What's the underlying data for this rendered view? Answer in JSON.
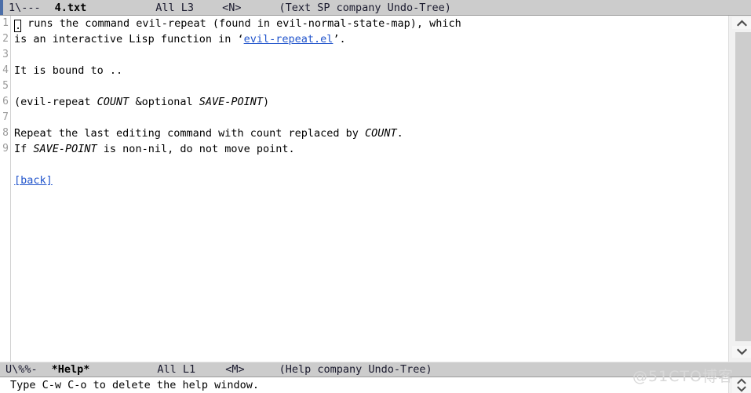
{
  "top_mode_line": {
    "flags": "1\\---",
    "buffer": "4.txt",
    "position": "All L3",
    "state": "<N>",
    "modes": "(Text SP company Undo-Tree)"
  },
  "bottom_mode_line": {
    "flags": "U\\%%-",
    "buffer": "*Help*",
    "position": "All L1",
    "state": "<M>",
    "modes": "(Help company Undo-Tree)"
  },
  "buffer": {
    "lines": [
      {
        "number": "1",
        "segments": [
          {
            "kind": "cursor",
            "text": "."
          },
          {
            "kind": "plain",
            "text": " runs the command evil-repeat (found in evil-normal-state-map), which"
          }
        ]
      },
      {
        "number": "2",
        "segments": [
          {
            "kind": "plain",
            "text": "is an interactive Lisp function in ‘"
          },
          {
            "kind": "link",
            "text": "evil-repeat.el"
          },
          {
            "kind": "plain",
            "text": "’."
          }
        ]
      },
      {
        "number": "3",
        "segments": []
      },
      {
        "number": "4",
        "segments": [
          {
            "kind": "plain",
            "text": "It is bound to .."
          }
        ]
      },
      {
        "number": "5",
        "segments": []
      },
      {
        "number": "6",
        "segments": [
          {
            "kind": "plain",
            "text": "(evil-repeat "
          },
          {
            "kind": "italic",
            "text": "COUNT"
          },
          {
            "kind": "plain",
            "text": " &optional "
          },
          {
            "kind": "italic",
            "text": "SAVE-POINT"
          },
          {
            "kind": "plain",
            "text": ")"
          }
        ]
      },
      {
        "number": "7",
        "segments": []
      },
      {
        "number": "8",
        "segments": [
          {
            "kind": "plain",
            "text": "Repeat the last editing command with count replaced by "
          },
          {
            "kind": "italic",
            "text": "COUNT"
          },
          {
            "kind": "plain",
            "text": "."
          }
        ]
      },
      {
        "number": "9",
        "segments": [
          {
            "kind": "plain",
            "text": "If "
          },
          {
            "kind": "italic",
            "text": "SAVE-POINT"
          },
          {
            "kind": "plain",
            "text": " is non-nil, do not move point."
          }
        ]
      },
      {
        "number": "",
        "segments": []
      },
      {
        "number": "",
        "segments": [
          {
            "kind": "link",
            "text": "[back]"
          }
        ]
      }
    ]
  },
  "echo_area": {
    "message": "Type C-w C-o to delete the help window."
  },
  "scrollbars": {
    "main": {
      "up_icon": "chevron-up-icon",
      "down_icon": "chevron-down-icon"
    },
    "help": {
      "up_icon": "chevron-up-icon",
      "down_icon": "chevron-down-icon"
    }
  },
  "watermark": {
    "text": "@51CTO博客"
  },
  "colors": {
    "mode_line_bg": "#cccccc",
    "link": "#2255cc",
    "line_number": "#9a9a9a",
    "accent": "#4b6ea8",
    "scrollbar_thumb": "#cdcdcd"
  }
}
